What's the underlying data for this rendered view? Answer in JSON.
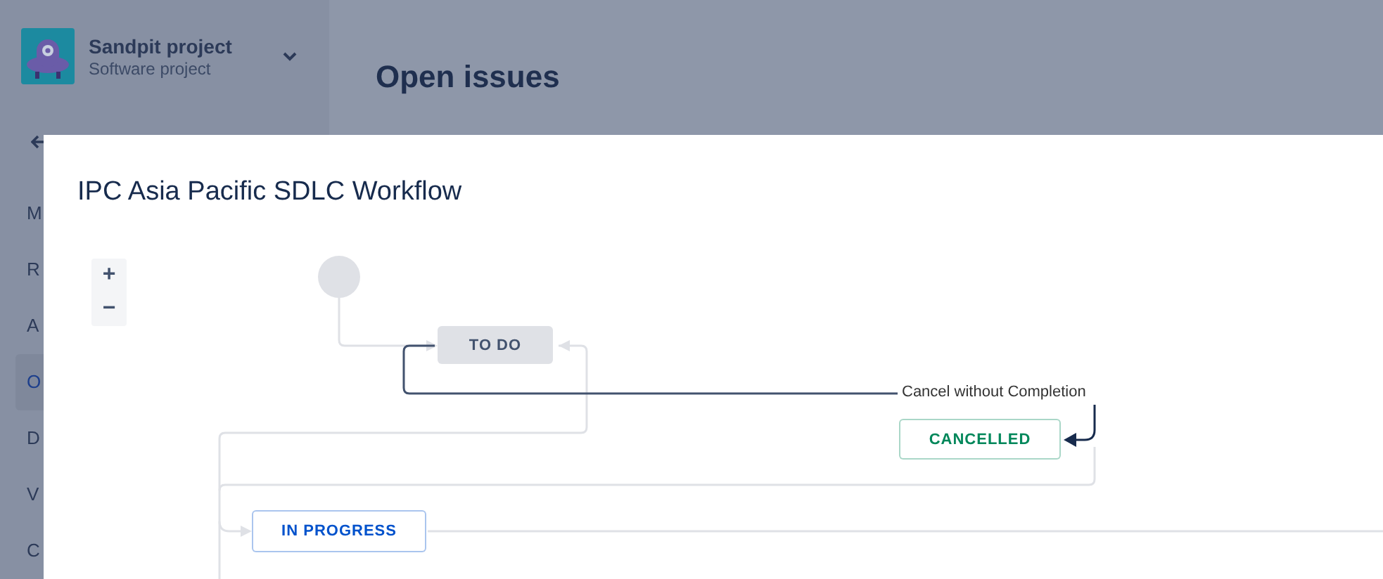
{
  "sidebar": {
    "project_name": "Sandpit project",
    "project_type": "Software project",
    "items": [
      {
        "label": "M",
        "selected": false
      },
      {
        "label": "R",
        "selected": false
      },
      {
        "label": "A",
        "selected": false
      },
      {
        "label": "O",
        "selected": true
      },
      {
        "label": "D",
        "selected": false
      },
      {
        "label": "V",
        "selected": false
      },
      {
        "label": "C",
        "selected": false
      }
    ]
  },
  "page": {
    "heading": "Open issues"
  },
  "dialog": {
    "title": "IPC Asia Pacific SDLC Workflow",
    "zoom_controls": [
      "+",
      "−"
    ],
    "nodes": [
      {
        "kind": "start"
      },
      {
        "kind": "filled",
        "label": "TO DO",
        "color": "#42526e"
      },
      {
        "kind": "outlined",
        "label": "CANCELLED",
        "color": "#00875a"
      },
      {
        "kind": "outlined",
        "label": "IN PROGRESS",
        "color": "#0052cc"
      }
    ],
    "transition_label": "Cancel without Completion"
  }
}
